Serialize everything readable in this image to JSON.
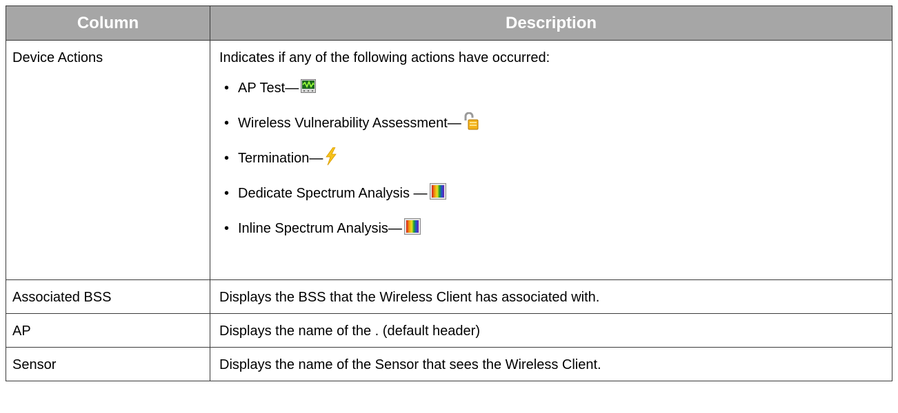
{
  "table": {
    "headers": {
      "column": "Column",
      "description": "Description"
    },
    "rows": [
      {
        "column": "Device Actions",
        "description": "Indicates if any of the following actions have occurred:",
        "actions": [
          {
            "label": "AP Test—",
            "icon": "ap-test-icon"
          },
          {
            "label": "Wireless Vulnerability Assessment—",
            "icon": "unlocked-padlock-icon"
          },
          {
            "label": "Termination—",
            "icon": "lightning-bolt-icon"
          },
          {
            "label": "Dedicate Spectrum Analysis —",
            "icon": "spectrum-icon"
          },
          {
            "label": "Inline Spectrum Analysis—",
            "icon": "spectrum-icon"
          }
        ]
      },
      {
        "column": "Associated BSS",
        "description": "Displays the BSS that the Wireless Client has associated with."
      },
      {
        "column": "AP",
        "description": "Displays the name of the . (default header)"
      },
      {
        "column": "Sensor",
        "description": "Displays the name of the Sensor that sees the Wireless Client."
      }
    ],
    "bullet": "•"
  },
  "colors": {
    "header_bg": "#a6a6a6",
    "header_text": "#ffffff",
    "border": "#3a3a3a"
  }
}
